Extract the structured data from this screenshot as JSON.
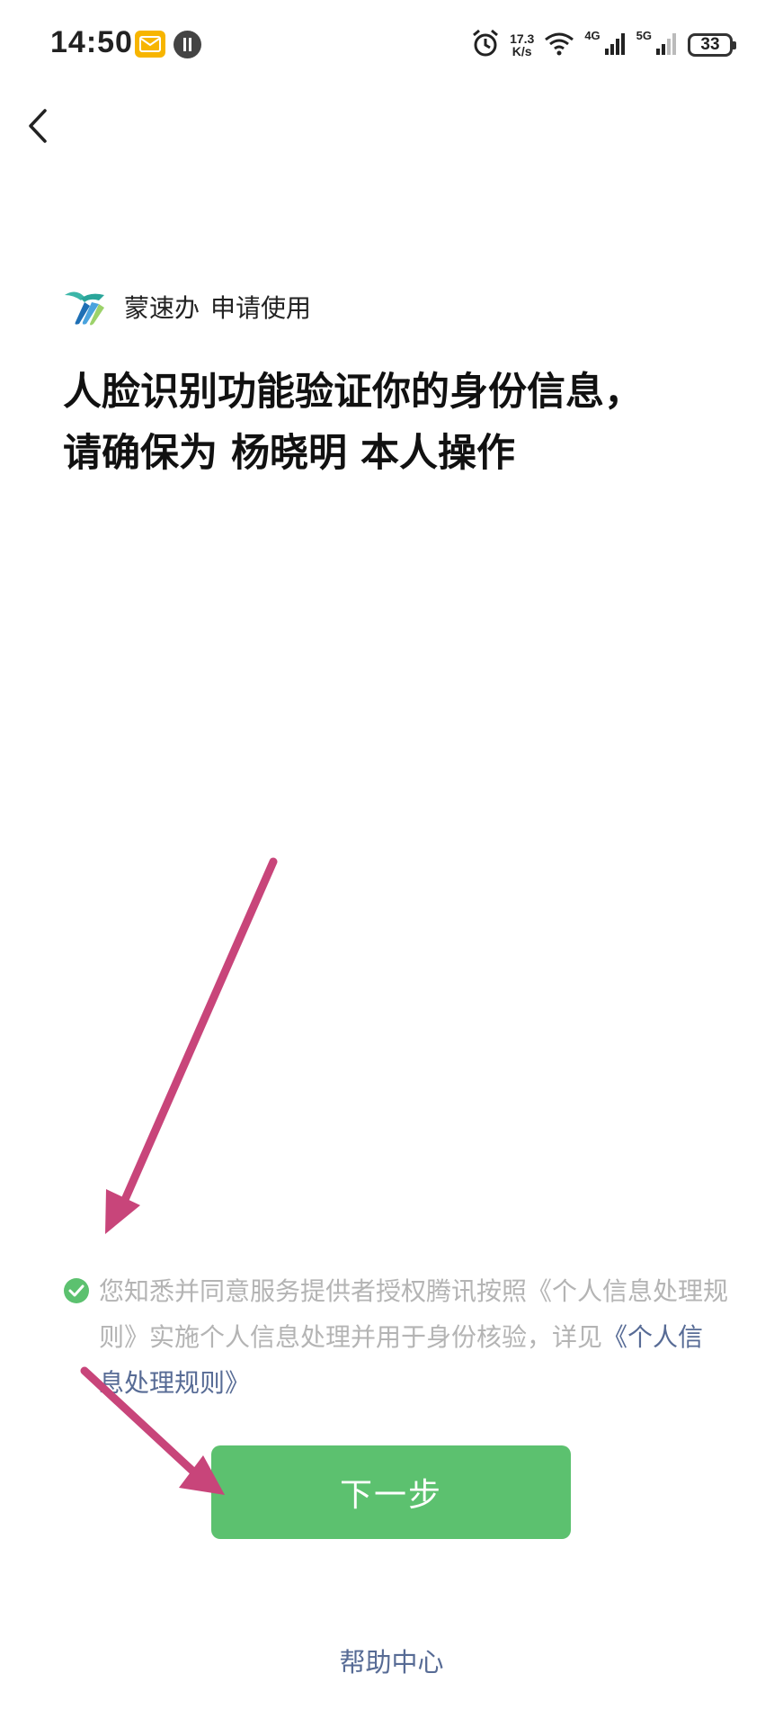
{
  "status_bar": {
    "time": "14:50",
    "net_speed_value": "17.3",
    "net_speed_unit": "K/s",
    "network_1": "4G",
    "network_2": "5G",
    "battery": "33",
    "icons": [
      "mail-notification-icon",
      "app-notification-icon",
      "alarm-icon",
      "wifi-icon",
      "signal-icon",
      "battery-icon"
    ]
  },
  "nav": {
    "back_icon": "chevron-left-icon"
  },
  "app": {
    "name": "蒙速办",
    "request_text": "申请使用"
  },
  "headline": {
    "line1": "人脸识别功能验证你的身份信息，",
    "line2_prefix": "请确保为 ",
    "person_name": "杨晓明",
    "line2_suffix": " 本人操作"
  },
  "consent": {
    "checked": true,
    "text": "您知悉并同意服务提供者授权腾讯按照《个人信息处理规则》实施个人信息处理并用于身份核验，详见",
    "link_text": "《个人信息处理规则》"
  },
  "primary_button": {
    "label": "下一步"
  },
  "footer": {
    "help_label": "帮助中心"
  },
  "colors": {
    "primary_green": "#5cc16f",
    "link_blue": "#576b95",
    "annotation_arrow": "#c8457a",
    "consent_gray": "#b4b4b4"
  }
}
